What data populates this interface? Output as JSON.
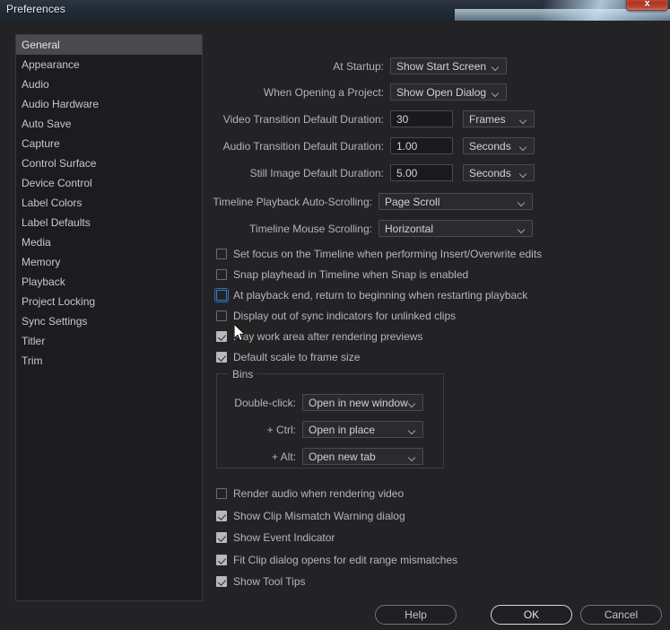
{
  "window": {
    "title": "Preferences",
    "close_icon": "close-icon",
    "close_label": "x"
  },
  "sidebar": {
    "items": [
      {
        "label": "General",
        "selected": true
      },
      {
        "label": "Appearance",
        "selected": false
      },
      {
        "label": "Audio",
        "selected": false
      },
      {
        "label": "Audio Hardware",
        "selected": false
      },
      {
        "label": "Auto Save",
        "selected": false
      },
      {
        "label": "Capture",
        "selected": false
      },
      {
        "label": "Control Surface",
        "selected": false
      },
      {
        "label": "Device Control",
        "selected": false
      },
      {
        "label": "Label Colors",
        "selected": false
      },
      {
        "label": "Label Defaults",
        "selected": false
      },
      {
        "label": "Media",
        "selected": false
      },
      {
        "label": "Memory",
        "selected": false
      },
      {
        "label": "Playback",
        "selected": false
      },
      {
        "label": "Project Locking",
        "selected": false
      },
      {
        "label": "Sync Settings",
        "selected": false
      },
      {
        "label": "Titler",
        "selected": false
      },
      {
        "label": "Trim",
        "selected": false
      }
    ]
  },
  "general": {
    "at_startup": {
      "label": "At Startup:",
      "value": "Show Start Screen"
    },
    "when_opening": {
      "label": "When Opening a Project:",
      "value": "Show Open Dialog"
    },
    "video_transition": {
      "label": "Video Transition Default Duration:",
      "value": "30",
      "unit": "Frames"
    },
    "audio_transition": {
      "label": "Audio Transition Default Duration:",
      "value": "1.00",
      "unit": "Seconds"
    },
    "still_image": {
      "label": "Still Image Default Duration:",
      "value": "5.00",
      "unit": "Seconds"
    },
    "auto_scrolling": {
      "label": "Timeline Playback Auto-Scrolling:",
      "value": "Page Scroll"
    },
    "mouse_scrolling": {
      "label": "Timeline Mouse Scrolling:",
      "value": "Horizontal"
    },
    "checkboxes_top": [
      {
        "label": "Set focus on the Timeline when performing Insert/Overwrite edits",
        "checked": false,
        "focused": false
      },
      {
        "label": "Snap playhead in Timeline when Snap is enabled",
        "checked": false,
        "focused": false
      },
      {
        "label": "At playback end, return to beginning when restarting playback",
        "checked": false,
        "focused": true
      },
      {
        "label": "Display out of sync indicators for unlinked clips",
        "checked": false,
        "focused": false
      },
      {
        "label": "Play work area after rendering previews",
        "checked": true,
        "focused": false
      },
      {
        "label": "Default scale to frame size",
        "checked": true,
        "focused": false
      }
    ],
    "bins": {
      "title": "Bins",
      "rows": [
        {
          "label": "Double-click:",
          "value": "Open in new window"
        },
        {
          "label": "+ Ctrl:",
          "value": "Open in place"
        },
        {
          "label": "+ Alt:",
          "value": "Open new tab"
        }
      ]
    },
    "checkboxes_bottom": [
      {
        "label": "Render audio when rendering video",
        "checked": false,
        "focused": false
      },
      {
        "label": "Show Clip Mismatch Warning dialog",
        "checked": true,
        "focused": false
      },
      {
        "label": "Show Event Indicator",
        "checked": true,
        "focused": false
      },
      {
        "label": "Fit Clip dialog opens for edit range mismatches",
        "checked": true,
        "focused": false
      },
      {
        "label": "Show Tool Tips",
        "checked": true,
        "focused": false
      }
    ]
  },
  "footer": {
    "help": "Help",
    "ok": "OK",
    "cancel": "Cancel"
  },
  "colors": {
    "background": "#232326",
    "panel": "#1c1c1f",
    "selection": "#4a4a4e",
    "focus_ring": "#2f6fc4",
    "close_button": "#c94b38"
  }
}
